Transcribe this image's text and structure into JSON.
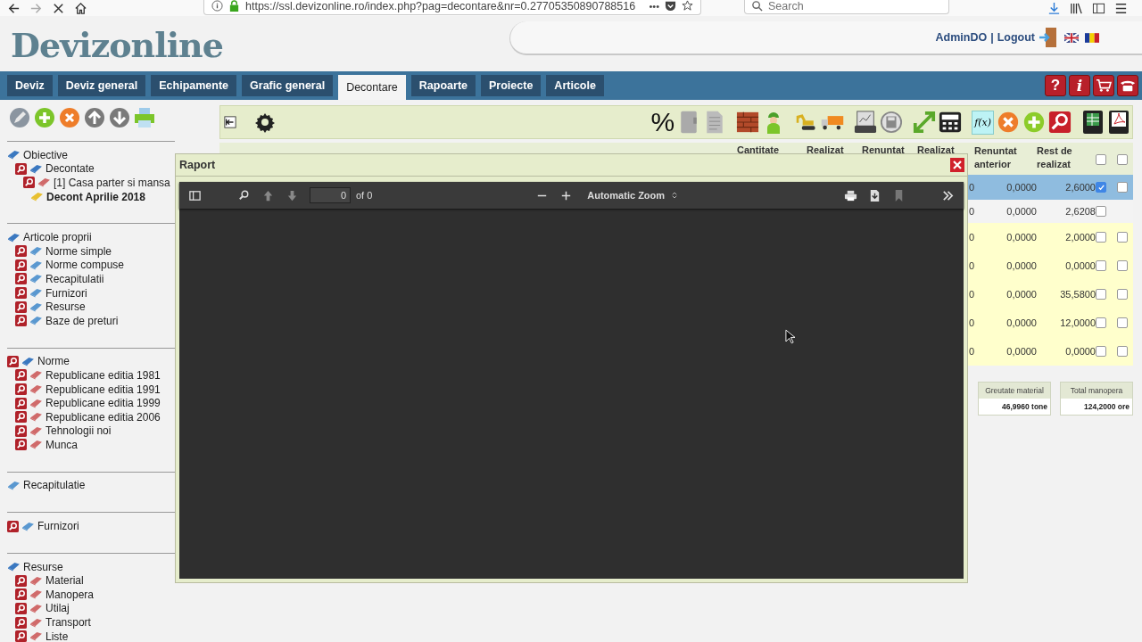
{
  "browser": {
    "url": "https://ssl.devizonline.ro/index.php?pag=decontare&nr=0.27705350890788516",
    "more": "•••",
    "search": {
      "placeholder": "Search"
    }
  },
  "header": {
    "logo": "Devizonline",
    "user": "AdminDO",
    "separator": "|",
    "logout": "Logout"
  },
  "nav": {
    "tabs": [
      {
        "label": "Deviz",
        "selected": false
      },
      {
        "label": "Deviz general",
        "selected": false
      },
      {
        "label": "Echipamente",
        "selected": false
      },
      {
        "label": "Grafic general",
        "selected": false
      },
      {
        "label": "Decontare",
        "selected": true
      },
      {
        "label": "Rapoarte",
        "selected": false
      },
      {
        "label": "Proiecte",
        "selected": false
      },
      {
        "label": "Articole",
        "selected": false
      }
    ],
    "icon_buttons": [
      {
        "kind": "help",
        "glyph": "?"
      },
      {
        "kind": "info",
        "glyph": "i"
      },
      {
        "kind": "cart"
      },
      {
        "kind": "phone"
      }
    ]
  },
  "sidebar": {
    "sections": [
      {
        "items": [
          {
            "label": "Obiective",
            "search": false,
            "color": "#3a78c0",
            "selected": false,
            "children": [
              {
                "label": "Decontate",
                "search": true,
                "color": "#3a78c0",
                "selected": false,
                "children": [
                  {
                    "label": "[1] Casa parter si mansa",
                    "search": true,
                    "color": "#d06a6a",
                    "selected": false,
                    "children": [
                      {
                        "label": "Decont Aprilie 2018",
                        "search": false,
                        "color": "#e8c030",
                        "selected": true
                      }
                    ]
                  }
                ]
              }
            ]
          }
        ]
      },
      {
        "items": [
          {
            "label": "Articole proprii",
            "search": false,
            "color": "#3a78c0",
            "selected": false,
            "children": [
              {
                "label": "Norme simple",
                "search": true,
                "color": "#5a98d0",
                "selected": false
              },
              {
                "label": "Norme compuse",
                "search": true,
                "color": "#5a98d0",
                "selected": false
              },
              {
                "label": "Recapitulatii",
                "search": true,
                "color": "#5a98d0",
                "selected": false
              },
              {
                "label": "Furnizori",
                "search": true,
                "color": "#5a98d0",
                "selected": false
              },
              {
                "label": "Resurse",
                "search": true,
                "color": "#5a98d0",
                "selected": false
              },
              {
                "label": "Baze de preturi",
                "search": true,
                "color": "#5a98d0",
                "selected": false
              }
            ]
          }
        ]
      },
      {
        "items": [
          {
            "label": "Norme",
            "search": true,
            "color": "#3a78c0",
            "selected": false,
            "children": [
              {
                "label": "Republicane editia 1981",
                "search": true,
                "color": "#d06a6a",
                "selected": false
              },
              {
                "label": "Republicane editia 1991",
                "search": true,
                "color": "#d06a6a",
                "selected": false
              },
              {
                "label": "Republicane editia 1999",
                "search": true,
                "color": "#d06a6a",
                "selected": false
              },
              {
                "label": "Republicane editia 2006",
                "search": true,
                "color": "#d06a6a",
                "selected": false
              },
              {
                "label": "Tehnologii noi",
                "search": true,
                "color": "#d06a6a",
                "selected": false
              },
              {
                "label": "Munca",
                "search": true,
                "color": "#d06a6a",
                "selected": false
              }
            ]
          }
        ]
      },
      {
        "items": [
          {
            "label": "Recapitulatie",
            "search": false,
            "color": "#5a98d0",
            "selected": false
          }
        ]
      },
      {
        "items": [
          {
            "label": "Furnizori",
            "search": true,
            "color": "#5a98d0",
            "selected": false
          }
        ]
      },
      {
        "items": [
          {
            "label": "Resurse",
            "search": false,
            "color": "#3a78c0",
            "selected": false,
            "children": [
              {
                "label": "Material",
                "search": true,
                "color": "#d06a6a",
                "selected": false
              },
              {
                "label": "Manopera",
                "search": true,
                "color": "#d06a6a",
                "selected": false
              },
              {
                "label": "Utilaj",
                "search": true,
                "color": "#d06a6a",
                "selected": false
              },
              {
                "label": "Transport",
                "search": true,
                "color": "#d06a6a",
                "selected": false
              },
              {
                "label": "Liste",
                "search": true,
                "color": "#d06a6a",
                "selected": false
              }
            ]
          }
        ]
      }
    ]
  },
  "toolbar": {
    "percent": "%",
    "function": "f(x)"
  },
  "table": {
    "columns": [
      "Cantitate",
      "Realizat",
      "Renuntat",
      "Realizat",
      "Renuntat anterior",
      "Rest de realizat"
    ],
    "header_checks": [
      {
        "checked": false
      },
      {
        "checked": false
      }
    ],
    "rows": [
      {
        "kind": "article",
        "selected": true,
        "column_5": "0",
        "renuntat_anterior": "0,0000",
        "rest_de_realizat": "2,6000",
        "checks": [
          {
            "checked": true
          },
          {
            "checked": false
          }
        ]
      },
      {
        "kind": "chapter",
        "selected": false,
        "column_5": "0",
        "renuntat_anterior": "0,0000",
        "rest_de_realizat": "2,6208",
        "checks": [
          {
            "checked": false
          }
        ]
      },
      {
        "kind": "article",
        "selected": false,
        "column_5": "0",
        "renuntat_anterior": "0,0000",
        "rest_de_realizat": "2,0000",
        "checks": [
          {
            "checked": false
          },
          {
            "checked": false
          }
        ]
      },
      {
        "kind": "article",
        "selected": false,
        "column_5": "0",
        "renuntat_anterior": "0,0000",
        "rest_de_realizat": "0,0000",
        "checks": [
          {
            "checked": false
          },
          {
            "checked": false
          }
        ]
      },
      {
        "kind": "article",
        "selected": false,
        "column_5": "0",
        "renuntat_anterior": "0,0000",
        "rest_de_realizat": "35,5800",
        "checks": [
          {
            "checked": false
          },
          {
            "checked": false
          }
        ]
      },
      {
        "kind": "article",
        "selected": false,
        "column_5": "0",
        "renuntat_anterior": "0,0000",
        "rest_de_realizat": "12,0000",
        "checks": [
          {
            "checked": false
          },
          {
            "checked": false
          }
        ]
      },
      {
        "kind": "article",
        "selected": false,
        "column_5": "0",
        "renuntat_anterior": "0,0000",
        "rest_de_realizat": "0,0000",
        "checks": [
          {
            "checked": false
          },
          {
            "checked": false
          }
        ]
      }
    ]
  },
  "summary": [
    {
      "label": "Greutate material",
      "value": "46,9960 tone"
    },
    {
      "label": "Total manopera",
      "value": "124,2000 ore"
    }
  ],
  "modal": {
    "title": "Raport",
    "viewer": {
      "page": "0",
      "of": "of 0",
      "zoom": "Automatic Zoom"
    }
  }
}
